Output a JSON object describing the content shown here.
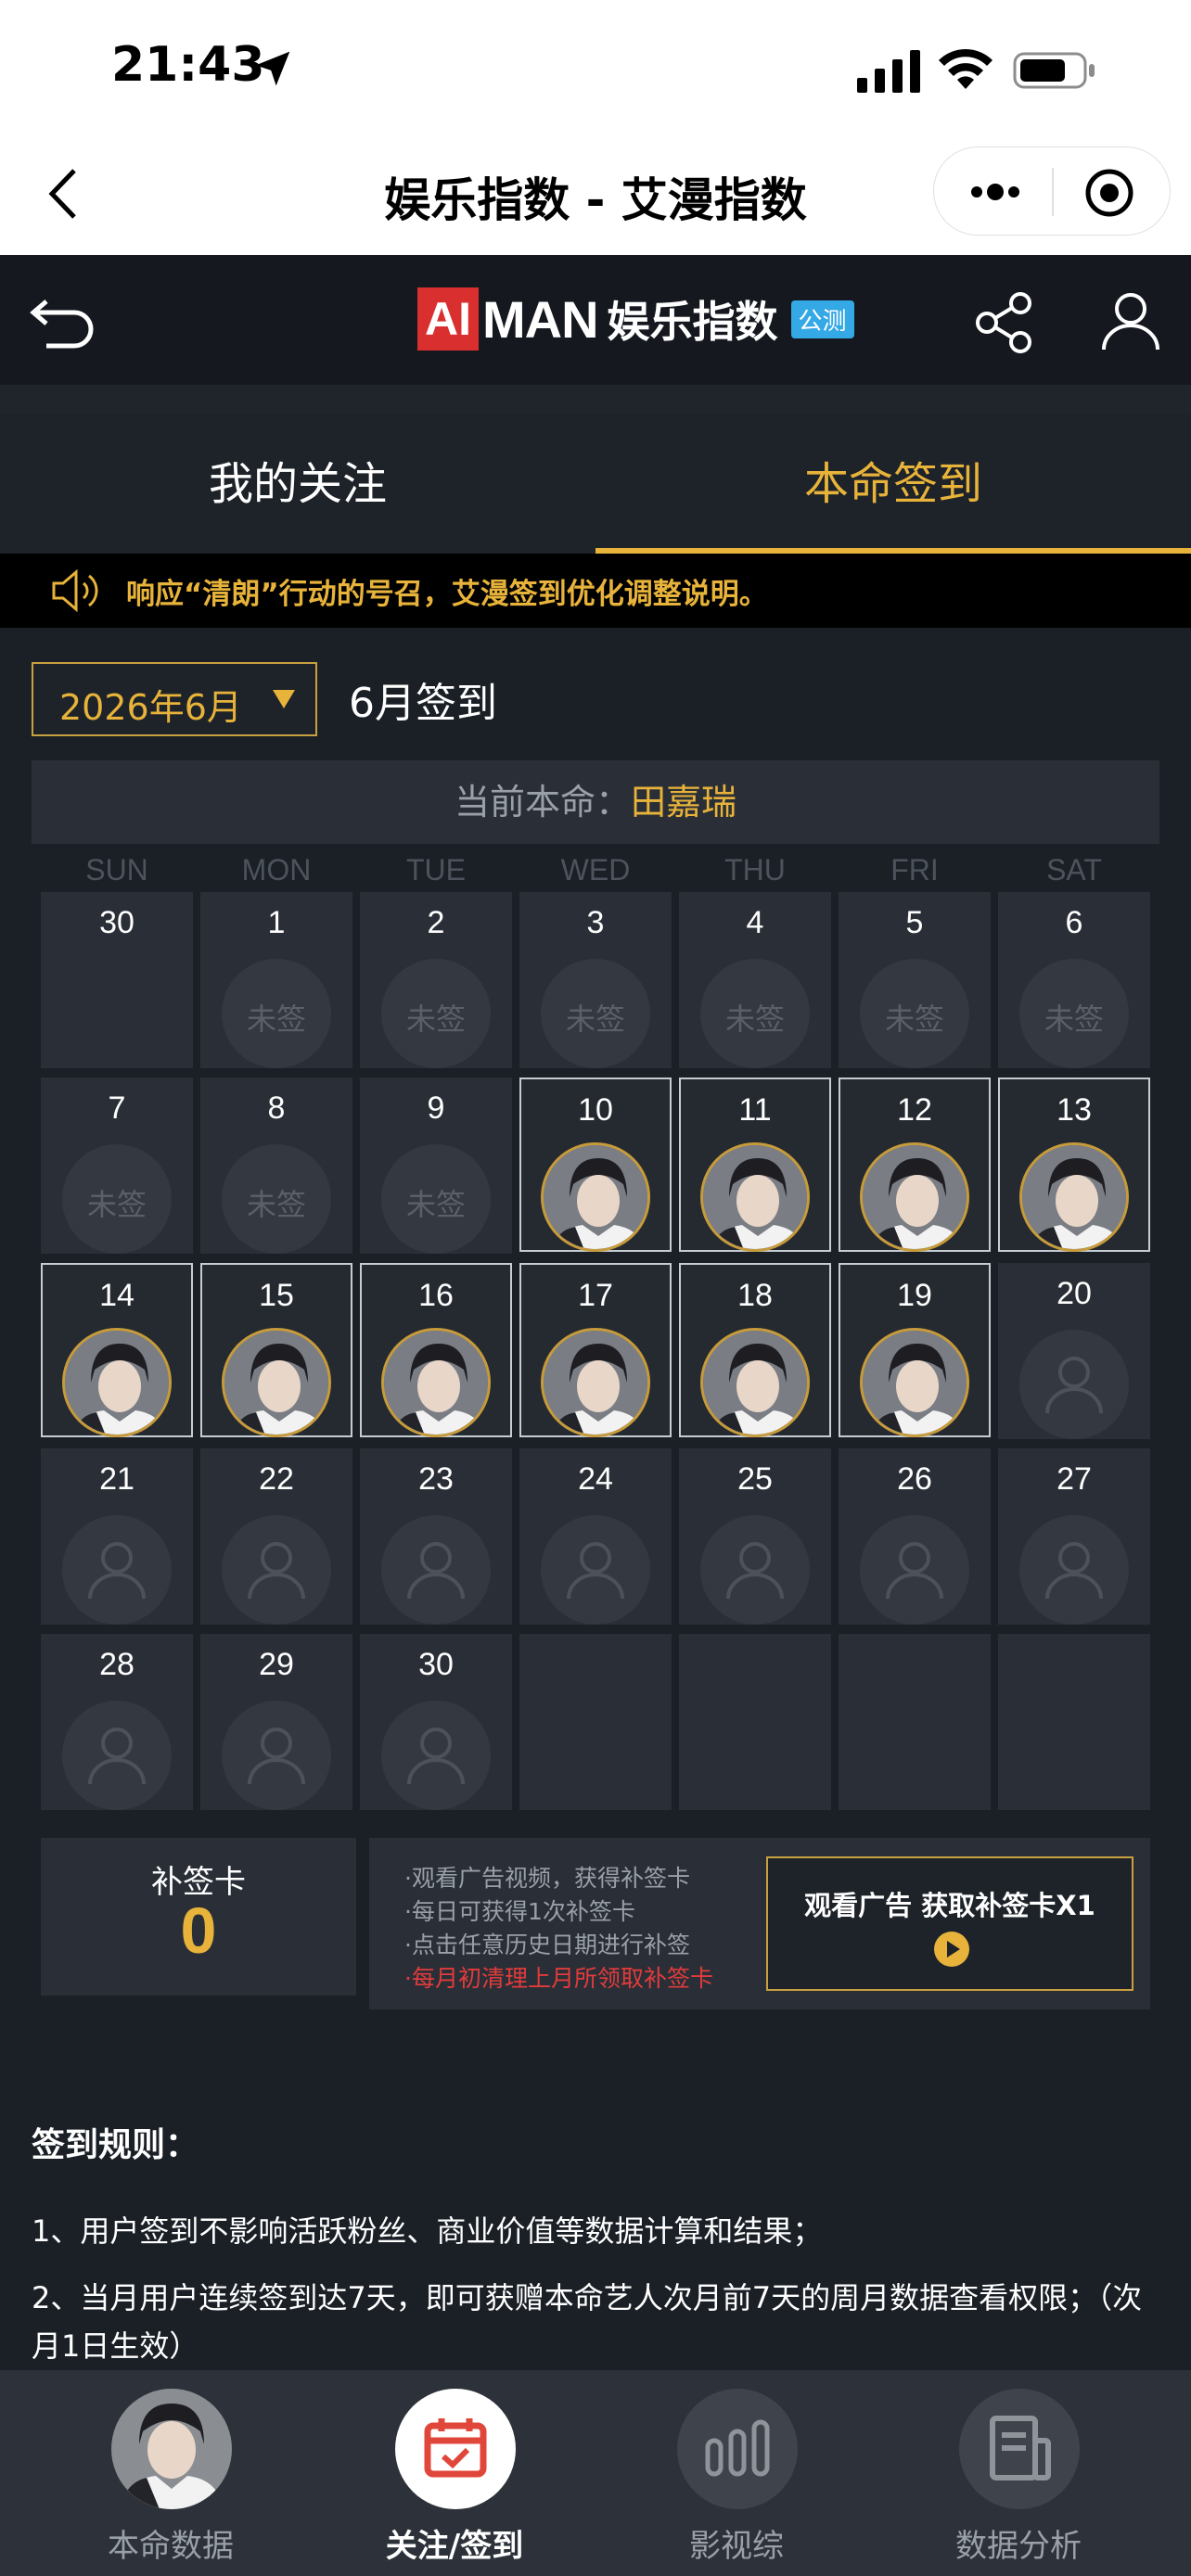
{
  "status_bar": {
    "time": "21:43"
  },
  "nav": {
    "title": "娱乐指数 - 艾漫指数"
  },
  "app_header": {
    "logo_ai": "AI",
    "logo_man": "MAN",
    "logo_cn": "娱乐指数",
    "beta_badge": "公测"
  },
  "tabs": [
    {
      "label": "我的关注"
    },
    {
      "label": "本命签到"
    }
  ],
  "notice": {
    "text": "响应“清朗”行动的号召，艾漫签到优化调整说明。"
  },
  "month": {
    "selector": "2026年6月",
    "title": "6月签到"
  },
  "current_idol": {
    "prefix": "当前本命：",
    "name": "田嘉瑞"
  },
  "weekdays": [
    "SUN",
    "MON",
    "TUE",
    "WED",
    "THU",
    "FRI",
    "SAT"
  ],
  "calendar": {
    "unsigned_label": "未签",
    "cells": [
      {
        "day": "30",
        "state": "prev"
      },
      {
        "day": "1",
        "state": "missed"
      },
      {
        "day": "2",
        "state": "missed"
      },
      {
        "day": "3",
        "state": "missed"
      },
      {
        "day": "4",
        "state": "missed"
      },
      {
        "day": "5",
        "state": "missed"
      },
      {
        "day": "6",
        "state": "missed"
      },
      {
        "day": "7",
        "state": "missed"
      },
      {
        "day": "8",
        "state": "missed"
      },
      {
        "day": "9",
        "state": "missed"
      },
      {
        "day": "10",
        "state": "signed"
      },
      {
        "day": "11",
        "state": "signed"
      },
      {
        "day": "12",
        "state": "signed"
      },
      {
        "day": "13",
        "state": "signed"
      },
      {
        "day": "14",
        "state": "signed"
      },
      {
        "day": "15",
        "state": "signed"
      },
      {
        "day": "16",
        "state": "signed"
      },
      {
        "day": "17",
        "state": "signed"
      },
      {
        "day": "18",
        "state": "signed"
      },
      {
        "day": "19",
        "state": "signed"
      },
      {
        "day": "20",
        "state": "future"
      },
      {
        "day": "21",
        "state": "future"
      },
      {
        "day": "22",
        "state": "future"
      },
      {
        "day": "23",
        "state": "future"
      },
      {
        "day": "24",
        "state": "future"
      },
      {
        "day": "25",
        "state": "future"
      },
      {
        "day": "26",
        "state": "future"
      },
      {
        "day": "27",
        "state": "future"
      },
      {
        "day": "28",
        "state": "future"
      },
      {
        "day": "29",
        "state": "future"
      },
      {
        "day": "30",
        "state": "future"
      },
      {
        "day": "",
        "state": "empty"
      },
      {
        "day": "",
        "state": "empty"
      },
      {
        "day": "",
        "state": "empty"
      },
      {
        "day": "",
        "state": "empty"
      }
    ]
  },
  "makeup_card": {
    "label": "补签卡",
    "count": "0"
  },
  "makeup_info": [
    "·观看广告视频，获得补签卡",
    "·每日可获得1次补签卡",
    "·点击任意历史日期进行补签",
    "·每月初清理上月所领取补签卡"
  ],
  "ad_button": {
    "label": "观看广告 获取补签卡X1"
  },
  "rules": {
    "title": "签到规则：",
    "items": [
      "1、用户签到不影响活跃粉丝、商业价值等数据计算和结果；",
      "2、当月用户连续签到达7天，即可获赠本命艺人次月前7天的周月数据查看权限；（次月1日生效）"
    ]
  },
  "tabbar": [
    {
      "label": "本命数据",
      "icon": "avatar"
    },
    {
      "label": "关注/签到",
      "icon": "calendar-check-icon"
    },
    {
      "label": "影视综",
      "icon": "bar-chart-icon"
    },
    {
      "label": "数据分析",
      "icon": "document-icon"
    }
  ],
  "colors": {
    "accent": "#e8b33a",
    "warn": "#e23b3b",
    "bg": "#1b2027"
  }
}
